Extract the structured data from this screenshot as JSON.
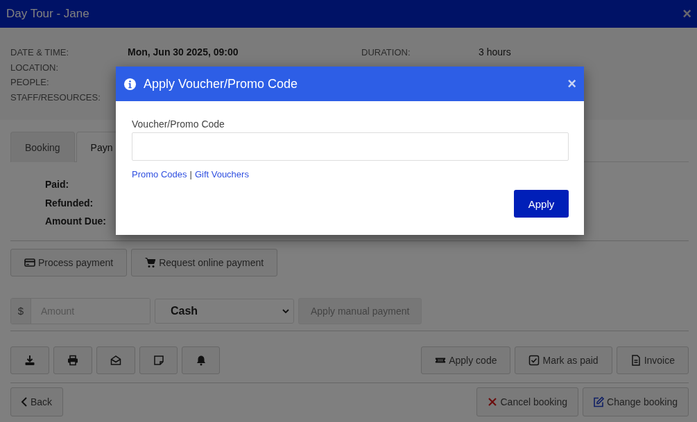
{
  "window": {
    "title": "Day Tour - Jane",
    "close": "×"
  },
  "details": {
    "left": [
      {
        "label": "DATE & TIME:",
        "value": "Mon, Jun 30 2025, 09:00",
        "bold": true
      },
      {
        "label": "LOCATION:"
      },
      {
        "label": "PEOPLE:"
      },
      {
        "label": "STAFF/RESOURCES:"
      }
    ],
    "right": [
      {
        "label": "DURATION:",
        "value": "3 hours",
        "bold": false
      }
    ]
  },
  "tabs": [
    {
      "label": "Booking",
      "selected": false
    },
    {
      "label": "Payn",
      "selected": true
    }
  ],
  "summary": [
    "Paid:",
    "Refunded:",
    "Amount Due:"
  ],
  "payment_buttons": [
    "Process payment",
    "Request online payment"
  ],
  "manual_payment": {
    "currency": "$",
    "placeholder": "Amount",
    "method": "Cash",
    "button": "Apply manual payment",
    "disabled": true
  },
  "actions": [
    "Apply code",
    "Mark as paid",
    "Invoice"
  ],
  "footer": {
    "back": "Back",
    "buttons": [
      "Cancel booking",
      "Change booking"
    ]
  },
  "modal": {
    "title": "Apply Voucher/Promo Code",
    "close": "×",
    "field_label": "Voucher/Promo Code",
    "links": [
      "Promo Codes",
      "Gift Vouchers"
    ],
    "separator": "|",
    "button": "Apply"
  }
}
